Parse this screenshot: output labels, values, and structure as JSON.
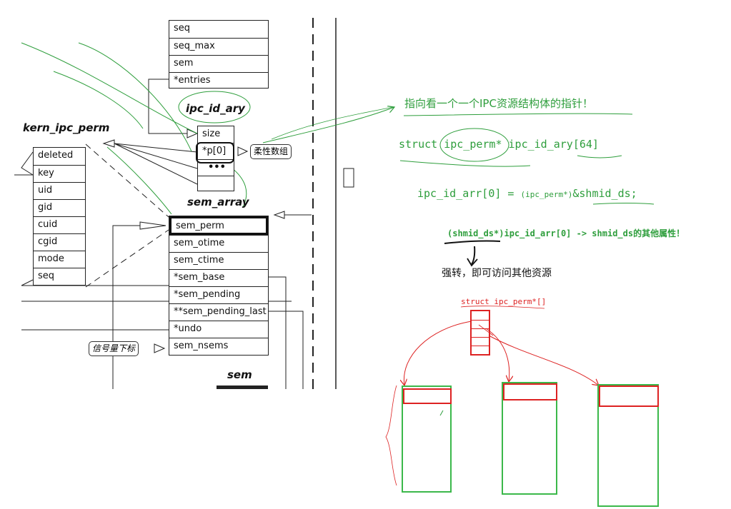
{
  "diagram": {
    "sem_top_fields": [
      "seq",
      "seq_max",
      "sem",
      "*entries"
    ],
    "ipc_id_ary_title": "ipc_id_ary",
    "ipc_id_ary_fields": [
      "size",
      "*p[0]",
      "•••"
    ],
    "flexible_array_note": "柔性数组",
    "kern_ipc_perm_title": "kern_ipc_perm",
    "kern_ipc_perm_fields": [
      "deleted",
      "key",
      "uid",
      "gid",
      "cuid",
      "cgid",
      "mode",
      "seq"
    ],
    "sem_array_title": "sem_array",
    "sem_array_fields": [
      "sem_perm",
      "sem_otime",
      "sem_ctime",
      "*sem_base",
      "*sem_pending",
      "**sem_pending_last",
      "*undo",
      "sem_nsems"
    ],
    "semaphore_index_note": "信号量下标",
    "sem_title": "sem"
  },
  "notes": {
    "pointer_note": "指向看一个一个IPC资源结构体的指针！",
    "struct_decl": "struct ipc_perm* ipc_id_ary[64]",
    "assign_left": "ipc_id_arr[0] = ",
    "assign_cast": "(ipc_perm*)",
    "assign_right": "&shmid_ds;",
    "access_line": "(shmid_ds*)ipc_id_arr[0] -> shmid_ds的其他属性！",
    "cast_note": "强转，即可访问其他资源",
    "red_label": "struct ipc_perm*[]"
  },
  "colors": {
    "green": "#2e9e3c",
    "red": "#d22222",
    "black": "#111111"
  }
}
